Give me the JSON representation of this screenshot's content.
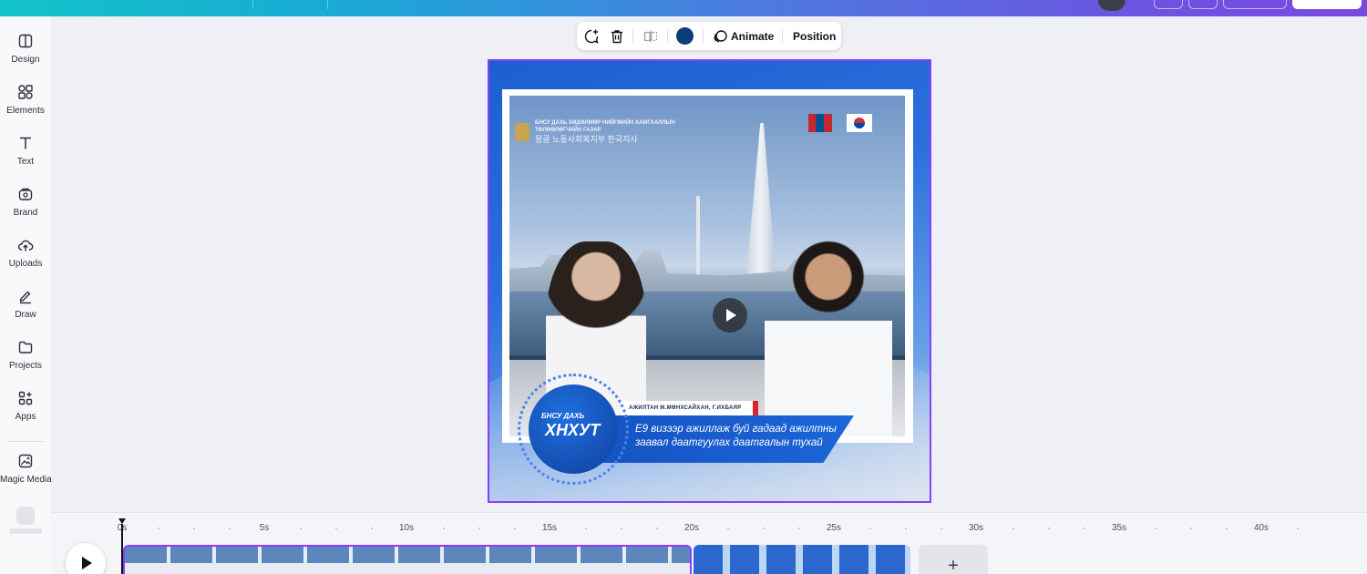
{
  "sidebar": {
    "items": [
      {
        "label": "Design",
        "icon": "layout-icon"
      },
      {
        "label": "Elements",
        "icon": "shapes-icon"
      },
      {
        "label": "Text",
        "icon": "text-t-icon"
      },
      {
        "label": "Brand",
        "icon": "brand-bag-icon"
      },
      {
        "label": "Uploads",
        "icon": "cloud-upload-icon"
      },
      {
        "label": "Draw",
        "icon": "pen-icon"
      },
      {
        "label": "Projects",
        "icon": "folder-icon"
      },
      {
        "label": "Apps",
        "icon": "apps-grid-icon"
      },
      {
        "label": "Magic Media",
        "icon": "magic-media-icon"
      }
    ]
  },
  "toolbar": {
    "animate_label": "Animate",
    "position_label": "Position",
    "color": "#0b3d7a"
  },
  "canvas": {
    "photo_header_mn": "БНСУ ДАХЬ ХӨДӨЛМӨР НИЙГМИЙН ХАМГААЛЛЫН ТӨЛӨӨЛӨГЧИЙН ГАЗАР",
    "photo_header_kr": "몽골 노동사회복지부 한국지사",
    "lower_third_names": "АЖИЛТАН М.МӨНХСАЙХАН, Г.ИХБАЯР",
    "lower_third_small": "БНСУ ДАХЬ",
    "lower_third_big": "ХНХУТ",
    "lower_third_subtitle": "E9 визээр ажиллаж буй гадаад ажилтны заавал даатгуулах даатгалын тухай"
  },
  "timeline": {
    "ticks": [
      "0s",
      "5s",
      "10s",
      "15s",
      "20s",
      "25s",
      "30s",
      "35s",
      "40s"
    ],
    "add_label": "+"
  },
  "colors": {
    "accent": "#8b3dff",
    "header_start": "#13c3c9",
    "header_end": "#7a49e0"
  }
}
